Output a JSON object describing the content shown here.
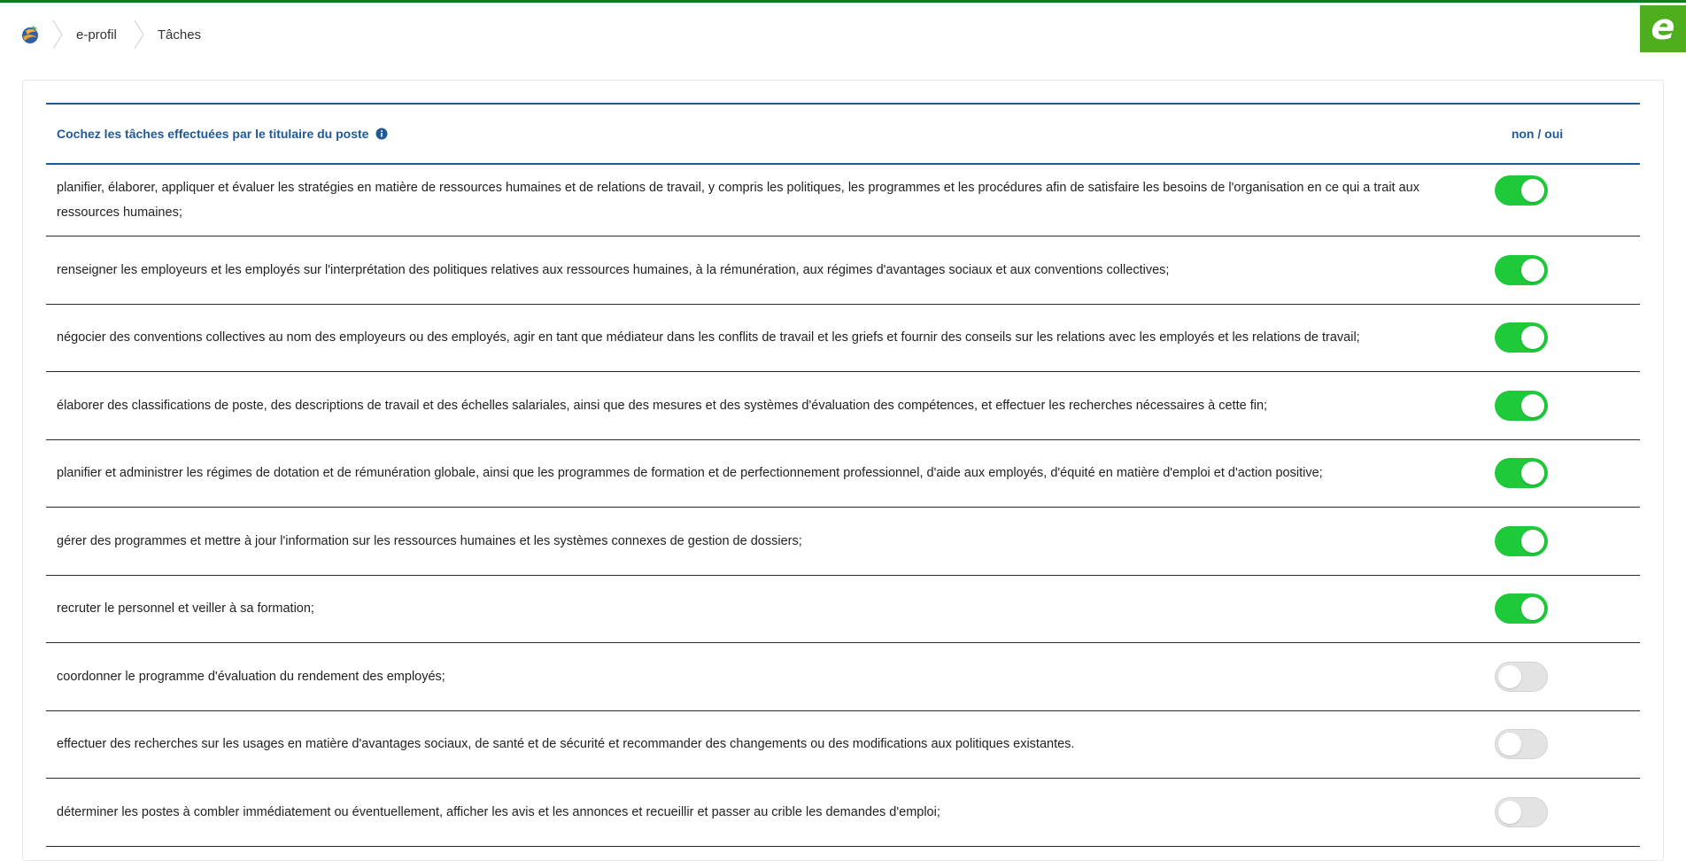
{
  "breadcrumb": {
    "items": [
      "e-profil",
      "Tâches"
    ]
  },
  "brand": {
    "letter": "e",
    "color": "#4fae1d"
  },
  "table": {
    "header_title": "Cochez les tâches effectuées par le titulaire du poste",
    "header_toggle_label": "non / oui",
    "accent_color": "#1f5a96",
    "toggle_on_color": "#1ec93a",
    "rows": [
      {
        "text": "planifier, élaborer, appliquer et évaluer les stratégies en matière de ressources humaines et de relations de travail, y compris les politiques, les programmes et les procédures afin de satisfaire les besoins de l'organisation en ce qui a trait aux ressources humaines;",
        "checked": true
      },
      {
        "text": "renseigner les employeurs et les employés sur l'interprétation des politiques relatives aux ressources humaines, à la rémunération, aux régimes d'avantages sociaux et aux conventions collectives;",
        "checked": true
      },
      {
        "text": "négocier des conventions collectives au nom des employeurs ou des employés, agir en tant que médiateur dans les conflits de travail et les griefs et fournir des conseils sur les relations avec les employés et les relations de travail;",
        "checked": true
      },
      {
        "text": "élaborer des classifications de poste, des descriptions de travail et des échelles salariales, ainsi que des mesures et des systèmes d'évaluation des compétences, et effectuer les recherches nécessaires à cette fin;",
        "checked": true
      },
      {
        "text": "planifier et administrer les régimes de dotation et de rémunération globale, ainsi que les programmes de formation et de perfectionnement professionnel, d'aide aux employés, d'équité en matière d'emploi et d'action positive;",
        "checked": true
      },
      {
        "text": "gérer des programmes et mettre à jour l'information sur les ressources humaines et les systèmes connexes de gestion de dossiers;",
        "checked": true
      },
      {
        "text": "recruter le personnel et veiller à sa formation;",
        "checked": true
      },
      {
        "text": "coordonner le programme d'évaluation du rendement des employés;",
        "checked": false
      },
      {
        "text": "effectuer des recherches sur les usages en matière d'avantages sociaux, de santé et de sécurité et recommander des changements ou des modifications aux politiques existantes.",
        "checked": false
      },
      {
        "text": "déterminer les postes à combler immédiatement ou éventuellement, afficher les avis et les annonces et recueillir et passer au crible les demandes d'emploi;",
        "checked": false
      }
    ]
  }
}
